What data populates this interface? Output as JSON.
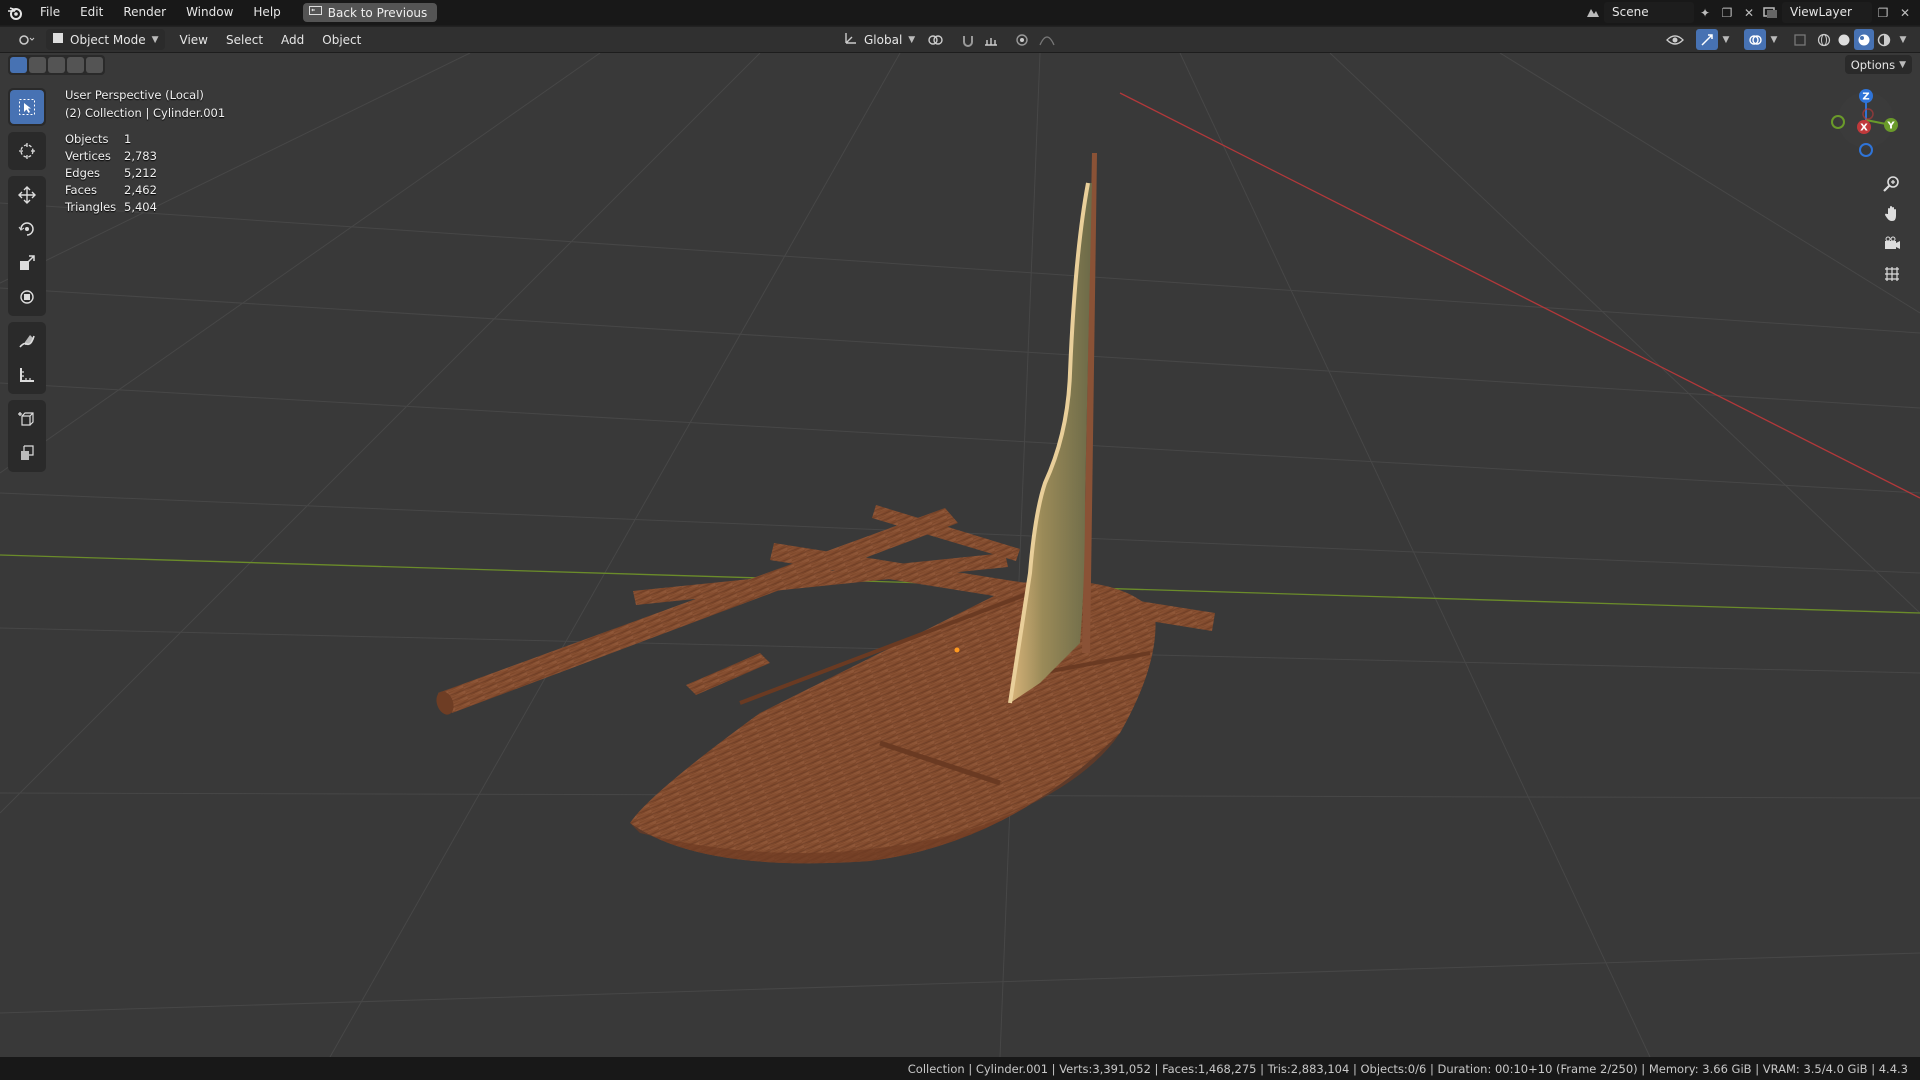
{
  "menubar": {
    "items": [
      "File",
      "Edit",
      "Render",
      "Window",
      "Help"
    ],
    "back_button": "Back to Previous",
    "scene": "Scene",
    "view_layer": "ViewLayer"
  },
  "header": {
    "mode": "Object Mode",
    "menus": [
      "View",
      "Select",
      "Add",
      "Object"
    ],
    "orientation": "Global",
    "options": "Options"
  },
  "viewport": {
    "perspective": "User Perspective (Local)",
    "collection_line": "(2) Collection | Cylinder.001",
    "stats": [
      {
        "label": "Objects",
        "value": "1"
      },
      {
        "label": "Vertices",
        "value": "2,783"
      },
      {
        "label": "Edges",
        "value": "5,212"
      },
      {
        "label": "Faces",
        "value": "2,462"
      },
      {
        "label": "Triangles",
        "value": "5,404"
      }
    ],
    "gizmo": {
      "z": "Z",
      "y": "Y",
      "x": "X"
    }
  },
  "statusbar": {
    "text": "Collection | Cylinder.001 | Verts:3,391,052 | Faces:1,468,275 | Tris:2,883,104 | Objects:0/6 | Duration: 00:10+10 (Frame 2/250) | Memory: 3.66 GiB | VRAM: 3.5/4.0 GiB | 4.4.3"
  },
  "colors": {
    "accent": "#4772b3",
    "viewport_bg": "#393939",
    "x_axis": "#c0393b",
    "y_axis": "#6a9a2a",
    "z_axis": "#2f74d8",
    "wood": "#8a5034"
  },
  "icons": [
    "blender-logo-icon",
    "select-box-icon",
    "cursor-icon",
    "move-icon",
    "rotate-icon",
    "scale-icon",
    "transform-icon",
    "annotate-icon",
    "measure-icon",
    "add-cube-icon",
    "extrude-icon",
    "zoom-icon",
    "hand-icon",
    "camera-icon",
    "grid-icon"
  ]
}
